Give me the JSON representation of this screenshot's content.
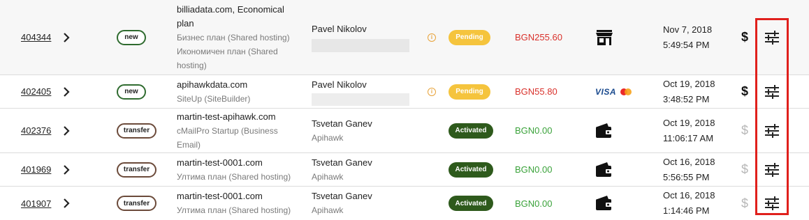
{
  "orders": [
    {
      "id": "404344",
      "type": "new",
      "services": [
        "billiadata.com, Economical plan"
      ],
      "plans": [
        "Бизнес план (Shared hosting)",
        "Икономичен план (Shared hosting)"
      ],
      "customer": "Pavel Nikolov",
      "company": "",
      "status": "Pending",
      "amount": "BGN255.60",
      "payment_icon": "storefront-icon",
      "date": "Nov 7, 2018",
      "time": "5:49:54 PM"
    },
    {
      "id": "402405",
      "type": "new",
      "services": [
        "apihawkdata.com"
      ],
      "plans": [
        "SiteUp (SiteBuilder)"
      ],
      "customer": "Pavel Nikolov",
      "company": "",
      "status": "Pending",
      "amount": "BGN55.80",
      "payment_icon": "card-icons",
      "visa_text": "VISA",
      "date": "Oct 19, 2018",
      "time": "3:48:52 PM"
    },
    {
      "id": "402376",
      "type": "transfer",
      "services": [
        "martin-test-apihawk.com"
      ],
      "plans": [
        "cMailPro Startup (Business Email)"
      ],
      "customer": "Tsvetan Ganev",
      "company": "Apihawk",
      "status": "Activated",
      "amount": "BGN0.00",
      "payment_icon": "wallet-icon",
      "date": "Oct 19, 2018",
      "time": "11:06:17 AM"
    },
    {
      "id": "401969",
      "type": "transfer",
      "services": [
        "martin-test-0001.com"
      ],
      "plans": [
        "Ултима план (Shared hosting)"
      ],
      "customer": "Tsvetan Ganev",
      "company": "Apihawk",
      "status": "Activated",
      "amount": "BGN0.00",
      "payment_icon": "wallet-icon",
      "date": "Oct 16, 2018",
      "time": "5:56:55 PM"
    },
    {
      "id": "401907",
      "type": "transfer",
      "services": [
        "martin-test-0001.com"
      ],
      "plans": [
        "Ултима план (Shared hosting)"
      ],
      "customer": "Tsvetan Ganev",
      "company": "Apihawk",
      "status": "Activated",
      "amount": "BGN0.00",
      "payment_icon": "wallet-icon",
      "date": "Oct 16, 2018",
      "time": "1:14:46 PM"
    }
  ],
  "colors": {
    "pending": "#f5c43d",
    "activated": "#2e5a1c",
    "amount_pending": "#d9312b",
    "amount_paid": "#3aa23a",
    "highlight": "#e0201c"
  }
}
